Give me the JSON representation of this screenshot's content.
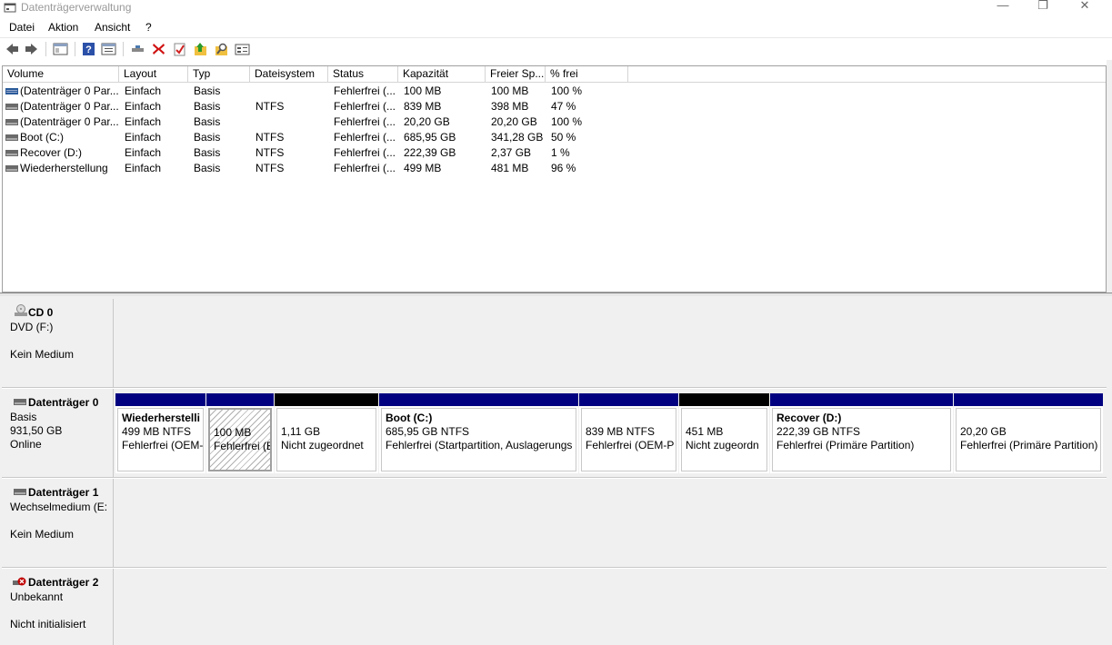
{
  "window": {
    "title": "Datenträgerverwaltung",
    "controls": {
      "minimize": "—",
      "maximize": "❐",
      "close": "✕"
    }
  },
  "menu": [
    "Datei",
    "Aktion",
    "Ansicht",
    "?"
  ],
  "toolbar": [
    "back-icon",
    "forward-icon",
    "console-tree-icon",
    "help-icon",
    "properties-icon",
    "connect-icon",
    "delete-icon",
    "check-icon",
    "up-folder-icon",
    "search-icon",
    "list-icon"
  ],
  "columns": [
    "Volume",
    "Layout",
    "Typ",
    "Dateisystem",
    "Status",
    "Kapazität",
    "Freier Sp...",
    "% frei"
  ],
  "volumes": [
    {
      "volume": "(Datenträger 0 Par...",
      "layout": "Einfach",
      "typ": "Basis",
      "fs": "",
      "status": "Fehlerfrei (...",
      "cap": "100 MB",
      "free": "100 MB",
      "pct": "100 %",
      "icon": "striped-volume-icon"
    },
    {
      "volume": "(Datenträger 0 Par...",
      "layout": "Einfach",
      "typ": "Basis",
      "fs": "NTFS",
      "status": "Fehlerfrei (...",
      "cap": "839 MB",
      "free": "398 MB",
      "pct": "47 %",
      "icon": "volume-icon"
    },
    {
      "volume": "(Datenträger 0 Par...",
      "layout": "Einfach",
      "typ": "Basis",
      "fs": "",
      "status": "Fehlerfrei (...",
      "cap": "20,20 GB",
      "free": "20,20 GB",
      "pct": "100 %",
      "icon": "volume-icon"
    },
    {
      "volume": "Boot (C:)",
      "layout": "Einfach",
      "typ": "Basis",
      "fs": "NTFS",
      "status": "Fehlerfrei (...",
      "cap": "685,95 GB",
      "free": "341,28 GB",
      "pct": "50 %",
      "icon": "volume-icon"
    },
    {
      "volume": "Recover (D:)",
      "layout": "Einfach",
      "typ": "Basis",
      "fs": "NTFS",
      "status": "Fehlerfrei (...",
      "cap": "222,39 GB",
      "free": "2,37 GB",
      "pct": "1 %",
      "icon": "volume-icon"
    },
    {
      "volume": "Wiederherstellung",
      "layout": "Einfach",
      "typ": "Basis",
      "fs": "NTFS",
      "status": "Fehlerfrei (...",
      "cap": "499 MB",
      "free": "481 MB",
      "pct": "96 %",
      "icon": "volume-icon"
    }
  ],
  "disks": {
    "cd0": {
      "name": "CD 0",
      "line2": "DVD (F:)",
      "line3": "Kein Medium"
    },
    "disk0": {
      "name": "Datenträger 0",
      "line2": "Basis",
      "line3": "931,50 GB",
      "line4": "Online"
    },
    "disk1": {
      "name": "Datenträger 1",
      "line2": "Wechselmedium (E:",
      "line3": "Kein Medium"
    },
    "disk2": {
      "name": "Datenträger 2",
      "line2": "Unbekannt",
      "line3": "Nicht initialisiert"
    }
  },
  "partitions": [
    {
      "name": "Wiederherstelli",
      "size": "499 MB NTFS",
      "status": "Fehlerfrei (OEM-",
      "kind": "primary"
    },
    {
      "name": "",
      "size": "100 MB",
      "status": "Fehlerfrei (E",
      "kind": "selected"
    },
    {
      "name": "",
      "size": "1,11 GB",
      "status": "Nicht zugeordnet",
      "kind": "unallocated"
    },
    {
      "name": "Boot  (C:)",
      "size": "685,95 GB NTFS",
      "status": "Fehlerfrei (Startpartition, Auslagerungs",
      "kind": "primary"
    },
    {
      "name": "",
      "size": "839 MB NTFS",
      "status": "Fehlerfrei (OEM-P",
      "kind": "primary"
    },
    {
      "name": "",
      "size": "451 MB",
      "status": "Nicht zugeordn",
      "kind": "unallocated"
    },
    {
      "name": "Recover  (D:)",
      "size": "222,39 GB NTFS",
      "status": "Fehlerfrei (Primäre Partition)",
      "kind": "primary"
    },
    {
      "name": "",
      "size": "20,20 GB",
      "status": "Fehlerfrei (Primäre Partition)",
      "kind": "primary"
    }
  ],
  "colors": {
    "primary": "#000080",
    "unallocated": "#000000"
  }
}
